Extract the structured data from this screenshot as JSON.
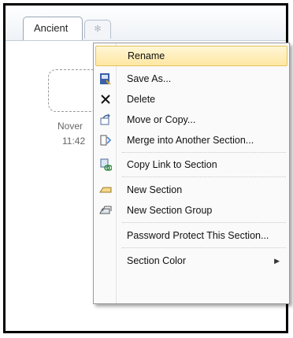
{
  "tabs": {
    "active": "Ancient",
    "new_tab_glyph": "✻"
  },
  "page": {
    "date": "Nover",
    "time": "11:42"
  },
  "context_menu": {
    "items": [
      {
        "label": "Rename",
        "icon": "none"
      },
      {
        "label": "Save As...",
        "icon": "save-as-icon"
      },
      {
        "label": "Delete",
        "icon": "delete-x-icon"
      },
      {
        "label": "Move or Copy...",
        "icon": "move-copy-icon"
      },
      {
        "label": "Merge into Another Section...",
        "icon": "merge-icon"
      },
      {
        "label": "Copy Link to Section",
        "icon": "copy-link-icon"
      },
      {
        "label": "New Section",
        "icon": "new-section-icon"
      },
      {
        "label": "New Section Group",
        "icon": "new-section-group-icon"
      },
      {
        "label": "Password Protect This Section...",
        "icon": "none"
      },
      {
        "label": "Section Color",
        "icon": "none",
        "submenu": true
      }
    ],
    "highlighted": "Rename",
    "highlight_color": "#ffe7a2"
  }
}
